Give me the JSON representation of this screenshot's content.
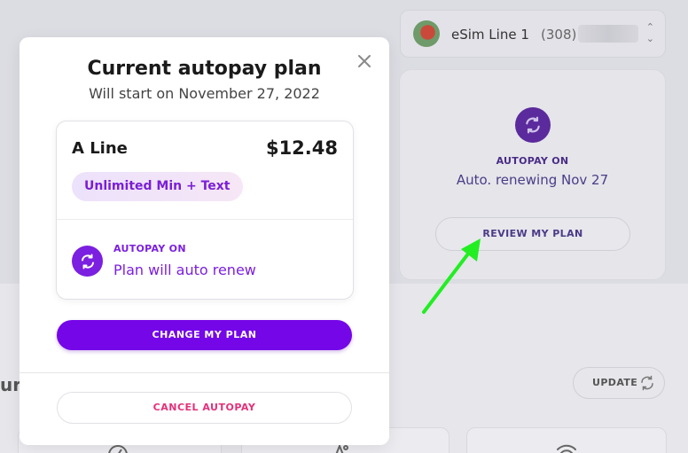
{
  "line_selector": {
    "name": "eSim Line 1",
    "number": "(308)"
  },
  "status_card": {
    "title": "AUTOPAY ON",
    "subtitle": "Auto. renewing Nov 27",
    "review_button": "REVIEW MY PLAN"
  },
  "background": {
    "partial_heading": "ur",
    "update_button": "UPDATE"
  },
  "modal": {
    "title": "Current autopay plan",
    "subtitle": "Will start on November 27, 2022",
    "plan": {
      "name": "A Line",
      "price": "$12.48",
      "badge": "Unlimited Min + Text",
      "autopay_title": "AUTOPAY ON",
      "autopay_subtitle": "Plan will auto renew"
    },
    "change_button": "CHANGE MY PLAN",
    "cancel_button": "CANCEL AUTOPAY"
  },
  "colors": {
    "accent_purple": "#7406e8",
    "cancel_pink": "#e5307a",
    "annotation_arrow": "#22ee22"
  },
  "icons": [
    "close-icon",
    "autopay-sync-icon",
    "refresh-icon",
    "chevron-updown-icon",
    "wifi-icon",
    "gauge-icon",
    "rocket-icon"
  ]
}
